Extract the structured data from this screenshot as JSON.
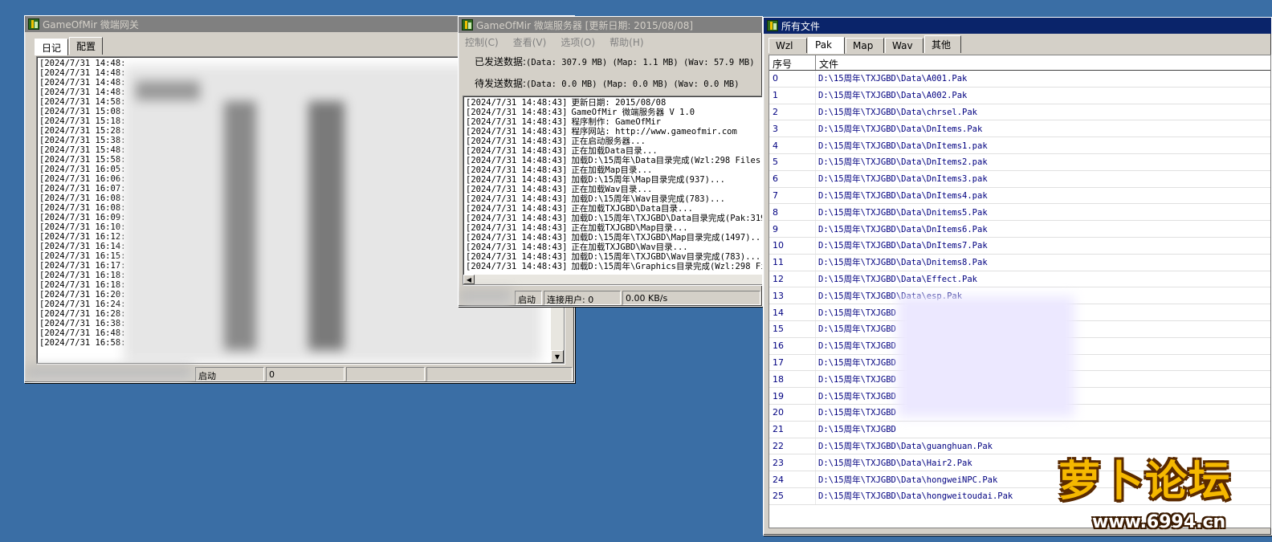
{
  "gateway": {
    "title": "GameOfMir 微端网关",
    "tabs": [
      "日记",
      "配置"
    ],
    "log_lines": [
      "[2024/7/31 14:48:",
      "[2024/7/31 14:48:",
      "[2024/7/31 14:48:",
      "[2024/7/31 14:48:",
      "[2024/7/31 14:58:",
      "[2024/7/31 15:08:",
      "[2024/7/31 15:18:",
      "[2024/7/31 15:28:",
      "[2024/7/31 15:38:",
      "[2024/7/31 15:48:",
      "[2024/7/31 15:58:",
      "[2024/7/31 16:05:",
      "[2024/7/31 16:06:",
      "[2024/7/31 16:07:",
      "[2024/7/31 16:08:",
      "[2024/7/31 16:08:",
      "[2024/7/31 16:09:",
      "[2024/7/31 16:10:",
      "[2024/7/31 16:12:",
      "[2024/7/31 16:14:",
      "[2024/7/31 16:15:",
      "[2024/7/31 16:17:",
      "[2024/7/31 16:18:",
      "[2024/7/31 16:18:",
      "[2024/7/31 16:20:",
      "[2024/7/31 16:24:",
      "[2024/7/31 16:28:",
      "[2024/7/31 16:38:",
      "[2024/7/31 16:48:",
      "[2024/7/31 16:58:"
    ],
    "status": {
      "state": "启动",
      "count": "0"
    }
  },
  "server": {
    "title": "GameOfMir 微端服务器 [更新日期: 2015/08/08]",
    "menu": [
      "控制(C)",
      "查看(V)",
      "选项(O)",
      "帮助(H)"
    ],
    "sent_label": "已发送数据:",
    "sent_value": "(Data: 307.9 MB) (Map: 1.1 MB) (Wav: 57.9 MB)",
    "pending_label": "待发送数据:",
    "pending_value": "(Data: 0.0 MB) (Map: 0.0 MB) (Wav: 0.0 MB)",
    "log": [
      {
        "ts": "[2024/7/31 14:48:43]",
        "msg": "更新日期: 2015/08/08"
      },
      {
        "ts": "[2024/7/31 14:48:43]",
        "msg": "GameOfMir 微端服务器 V 1.0"
      },
      {
        "ts": "[2024/7/31 14:48:43]",
        "msg": "程序制作: GameOfMir"
      },
      {
        "ts": "[2024/7/31 14:48:43]",
        "msg": "程序网站: http://www.gameofmir.com"
      },
      {
        "ts": "[2024/7/31 14:48:43]",
        "msg": "正在启动服务器..."
      },
      {
        "ts": "[2024/7/31 14:48:43]",
        "msg": "正在加载Data目录..."
      },
      {
        "ts": "[2024/7/31 14:48:43]",
        "msg": "加载D:\\15周年\\Data目录完成(Wzl:298 Files:1"
      },
      {
        "ts": "[2024/7/31 14:48:43]",
        "msg": "正在加载Map目录..."
      },
      {
        "ts": "[2024/7/31 14:48:43]",
        "msg": "加载D:\\15周年\\Map目录完成(937)..."
      },
      {
        "ts": "[2024/7/31 14:48:43]",
        "msg": "正在加载Wav目录..."
      },
      {
        "ts": "[2024/7/31 14:48:43]",
        "msg": "加载D:\\15周年\\Wav目录完成(783)..."
      },
      {
        "ts": "[2024/7/31 14:48:43]",
        "msg": "正在加载TXJGBD\\Data目录..."
      },
      {
        "ts": "[2024/7/31 14:48:43]",
        "msg": "加载D:\\15周年\\TXJGBD\\Data目录完成(Pak:319"
      },
      {
        "ts": "[2024/7/31 14:48:43]",
        "msg": "正在加载TXJGBD\\Map目录..."
      },
      {
        "ts": "[2024/7/31 14:48:43]",
        "msg": "加载D:\\15周年\\TXJGBD\\Map目录完成(1497)..."
      },
      {
        "ts": "[2024/7/31 14:48:43]",
        "msg": "正在加载TXJGBD\\Wav目录..."
      },
      {
        "ts": "[2024/7/31 14:48:43]",
        "msg": "加载D:\\15周年\\TXJGBD\\Wav目录完成(783)..."
      },
      {
        "ts": "[2024/7/31 14:48:43]",
        "msg": "加载D:\\15周年\\Graphics目录完成(Wzl:298 Fil"
      }
    ],
    "status": {
      "state": "启动",
      "users": "连接用户: 0",
      "speed": "0.00 KB/s"
    }
  },
  "files": {
    "title": "所有文件",
    "tabs": [
      "Wzl",
      "Pak",
      "Map",
      "Wav",
      "其他"
    ],
    "columns": {
      "index": "序号",
      "file": "文件"
    },
    "rows": [
      {
        "i": "0",
        "p": "D:\\15周年\\TXJGBD\\Data\\A001.Pak"
      },
      {
        "i": "1",
        "p": "D:\\15周年\\TXJGBD\\Data\\A002.Pak"
      },
      {
        "i": "2",
        "p": "D:\\15周年\\TXJGBD\\Data\\chrsel.Pak"
      },
      {
        "i": "3",
        "p": "D:\\15周年\\TXJGBD\\Data\\DnItems.Pak"
      },
      {
        "i": "4",
        "p": "D:\\15周年\\TXJGBD\\Data\\DnItems1.pak"
      },
      {
        "i": "5",
        "p": "D:\\15周年\\TXJGBD\\Data\\DnItems2.pak"
      },
      {
        "i": "6",
        "p": "D:\\15周年\\TXJGBD\\Data\\DnItems3.pak"
      },
      {
        "i": "7",
        "p": "D:\\15周年\\TXJGBD\\Data\\DnItems4.pak"
      },
      {
        "i": "8",
        "p": "D:\\15周年\\TXJGBD\\Data\\Dnitems5.Pak"
      },
      {
        "i": "9",
        "p": "D:\\15周年\\TXJGBD\\Data\\DnItems6.Pak"
      },
      {
        "i": "10",
        "p": "D:\\15周年\\TXJGBD\\Data\\DnItems7.Pak"
      },
      {
        "i": "11",
        "p": "D:\\15周年\\TXJGBD\\Data\\Dnitems8.Pak"
      },
      {
        "i": "12",
        "p": "D:\\15周年\\TXJGBD\\Data\\Effect.Pak"
      },
      {
        "i": "13",
        "p": "D:\\15周年\\TXJGBD\\Data\\esp.Pak"
      },
      {
        "i": "14",
        "p": "D:\\15周年\\TXJGBD"
      },
      {
        "i": "15",
        "p": "D:\\15周年\\TXJGBD"
      },
      {
        "i": "16",
        "p": "D:\\15周年\\TXJGBD"
      },
      {
        "i": "17",
        "p": "D:\\15周年\\TXJGBD"
      },
      {
        "i": "18",
        "p": "D:\\15周年\\TXJGBD"
      },
      {
        "i": "19",
        "p": "D:\\15周年\\TXJGBD"
      },
      {
        "i": "20",
        "p": "D:\\15周年\\TXJGBD"
      },
      {
        "i": "21",
        "p": "D:\\15周年\\TXJGBD"
      },
      {
        "i": "22",
        "p": "D:\\15周年\\TXJGBD\\Data\\guanghuan.Pak"
      },
      {
        "i": "23",
        "p": "D:\\15周年\\TXJGBD\\Data\\Hair2.Pak"
      },
      {
        "i": "24",
        "p": "D:\\15周年\\TXJGBD\\Data\\hongweiNPC.Pak"
      },
      {
        "i": "25",
        "p": "D:\\15周年\\TXJGBD\\Data\\hongweitoudai.Pak"
      }
    ]
  },
  "watermark": {
    "text": "萝卜论坛",
    "url": "www.6994.cn"
  }
}
